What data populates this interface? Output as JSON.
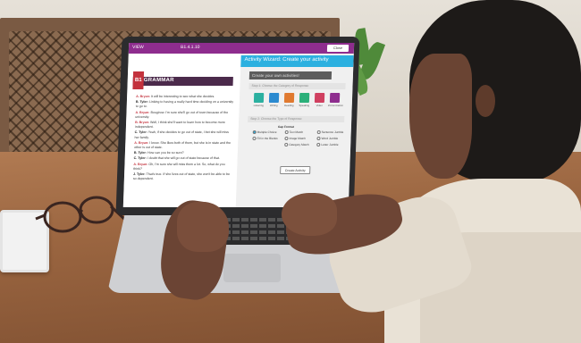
{
  "screen": {
    "topbar": {
      "view_label": "VIEW",
      "unit_code": "B1.4.1.10",
      "close_label": "Close"
    },
    "left_panel": {
      "level_badge": "B1",
      "section_title": "GRAMMAR",
      "dialogue": [
        {
          "speaker": "A. Bryan:",
          "text": "It will be interesting to see what she decides.",
          "accent": "red"
        },
        {
          "speaker": "B. Tyler:",
          "text": "Linking to having a really hard time deciding on a university to go to.",
          "accent": "dark"
        },
        {
          "speaker": "A. Bryan:",
          "text": "Bougirow. I'm sure she'll go out of town because of the university.",
          "accent": "red"
        },
        {
          "speaker": "B. Bryan:",
          "text": "Well, I think she'll want to learn how to become more independent.",
          "accent": "red"
        },
        {
          "speaker": "C. Tyler:",
          "text": "Yeah, if she decides to go out of state, I bet she will miss her family.",
          "accent": "dark"
        },
        {
          "speaker": "A. Bryan:",
          "text": "I know. She likes both of them, but she is in state and the other is out of state.",
          "accent": "red"
        },
        {
          "speaker": "B. Tyler:",
          "text": "How can you be so sure?",
          "accent": "dark"
        },
        {
          "speaker": "C. Tyler:",
          "text": "I doubt that she will go out of state because of that.",
          "accent": "dark"
        },
        {
          "speaker": "A. Bryan:",
          "text": "Oh, I'm sure she will miss them a lot. So, what do you think?",
          "accent": "red"
        },
        {
          "speaker": "J. Tyler:",
          "text": "That's true. If she lives out of state, she won't be able to be so dependent.",
          "accent": "dark"
        }
      ]
    },
    "right_panel": {
      "wizard_title": "Activity Wizard: Create your activity",
      "name_placeholder": "Create your own activities!",
      "step1_label": "Step 1: Choose the Category of Response",
      "activity_types": [
        {
          "label": "Listening",
          "color": "#2bb0a0"
        },
        {
          "label": "Writing",
          "color": "#2b8ad0"
        },
        {
          "label": "Reading",
          "color": "#e07a30"
        },
        {
          "label": "Speaking",
          "color": "#2bb07a"
        },
        {
          "label": "Video",
          "color": "#d04060"
        },
        {
          "label": "Pronunciation",
          "color": "#8e2d8e"
        }
      ],
      "step2_label": "Step 2: Choose the Type of Response",
      "group_label": "Gap Format",
      "options": [
        {
          "label": "Multiple Choice",
          "selected": true
        },
        {
          "label": "Text Match",
          "selected": false
        },
        {
          "label": "Sentence Jumble",
          "selected": false
        },
        {
          "label": "Fill in the Blanks",
          "selected": false
        },
        {
          "label": "Image Match",
          "selected": false
        },
        {
          "label": "Word Jumble",
          "selected": false
        },
        {
          "label": "Category Match",
          "selected": false
        },
        {
          "label": "Letter Jumble",
          "selected": false
        }
      ],
      "create_button": "Create Activity"
    }
  }
}
